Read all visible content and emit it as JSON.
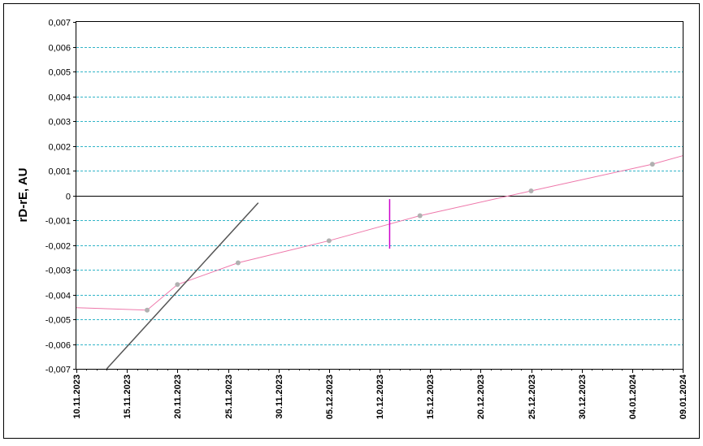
{
  "chart_data": {
    "type": "line",
    "xlabel": "",
    "ylabel": "rD-rE, AU",
    "ylim": [
      -0.007,
      0.007
    ],
    "xlim": [
      "2023-11-10",
      "2024-01-09"
    ],
    "x_ticks": [
      "10.11.2023",
      "15.11.2023",
      "20.11.2023",
      "25.11.2023",
      "30.11.2023",
      "05.12.2023",
      "10.12.2023",
      "15.12.2023",
      "20.12.2023",
      "25.12.2023",
      "30.12.2023",
      "04.01.2024",
      "09.01.2024"
    ],
    "y_ticks": [
      "-0,007",
      "-0,006",
      "-0,005",
      "-0,004",
      "-0,003",
      "-0,002",
      "-0,001",
      "0",
      "0,001",
      "0,002",
      "0,003",
      "0,004",
      "0,005",
      "0,006",
      "0,007"
    ],
    "grid": true,
    "zero_line": true,
    "series": [
      {
        "style": "pink-line",
        "color": "#ee77aa",
        "points": [
          {
            "x": "2023-11-10",
            "y": -0.00453
          },
          {
            "x": "2023-11-17",
            "y": -0.00463
          },
          {
            "x": "2023-11-20",
            "y": -0.0036
          },
          {
            "x": "2023-11-26",
            "y": -0.00272
          },
          {
            "x": "2023-12-05",
            "y": -0.00183
          },
          {
            "x": "2023-12-14",
            "y": -0.00082
          },
          {
            "x": "2023-12-25",
            "y": 0.00018
          },
          {
            "x": "2024-01-06",
            "y": 0.00126
          },
          {
            "x": "2024-01-09",
            "y": 0.0016
          }
        ]
      },
      {
        "style": "grey-markers",
        "color": "#b0b0b0",
        "points": [
          {
            "x": "2023-11-17",
            "y": -0.00463
          },
          {
            "x": "2023-11-20",
            "y": -0.0036
          },
          {
            "x": "2023-11-26",
            "y": -0.00272
          },
          {
            "x": "2023-12-05",
            "y": -0.00183
          },
          {
            "x": "2023-12-14",
            "y": -0.00082
          },
          {
            "x": "2023-12-25",
            "y": 0.00018
          },
          {
            "x": "2024-01-06",
            "y": 0.00126
          }
        ]
      },
      {
        "style": "dark-line",
        "color": "#555555",
        "points": [
          {
            "x": "2023-11-13",
            "y": -0.007
          },
          {
            "x": "2023-11-28",
            "y": -0.0003
          }
        ]
      }
    ],
    "marker_line": {
      "color": "#cc00cc",
      "x": "2023-12-11",
      "y_range": [
        -0.00215,
        -0.00015
      ]
    }
  }
}
